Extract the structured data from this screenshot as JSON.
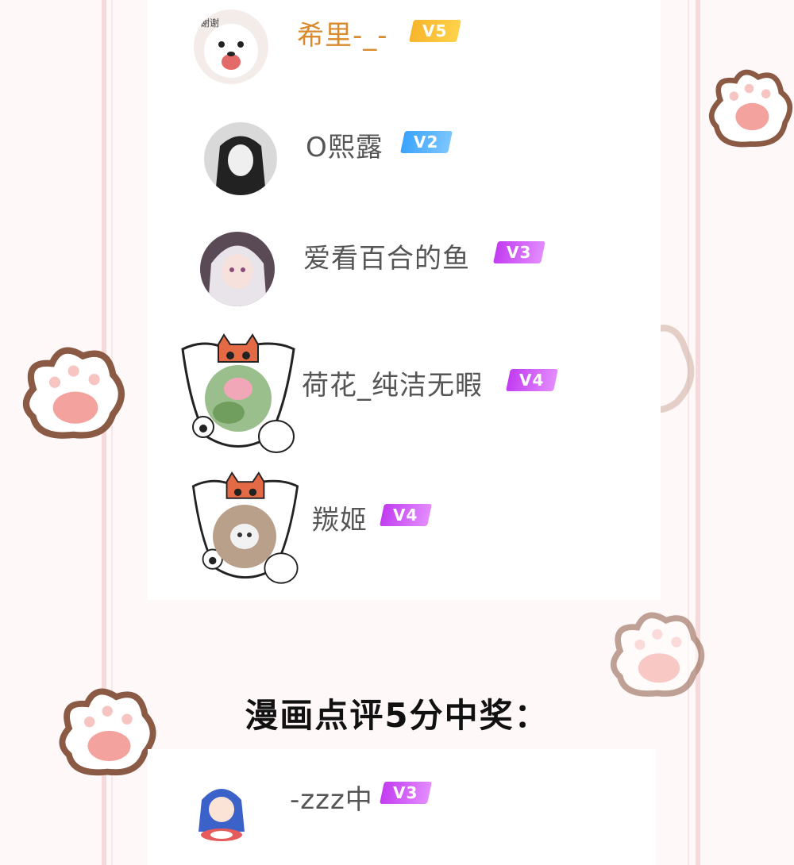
{
  "users": [
    {
      "name": "希里-_-",
      "level": "V5"
    },
    {
      "name": "O熙露",
      "level": "V2"
    },
    {
      "name": "爱看百合的鱼",
      "level": "V3"
    },
    {
      "name": "荷花_纯洁无暇",
      "level": "V4"
    },
    {
      "name": "羰姬",
      "level": "V4"
    }
  ],
  "section": {
    "title": "漫画点评5分中奖："
  },
  "bottom_users": [
    {
      "name": "-zzz中",
      "level": "V3"
    }
  ],
  "avatar_caption": "谢谢",
  "colors": {
    "gold_name": "#d98a2c",
    "v2": "#3aa3ff",
    "v3v4": "#c23cf0",
    "v5": "#f7b52c",
    "paw_outline": "#8a5a44",
    "paw_pad": "#f4a29d"
  }
}
